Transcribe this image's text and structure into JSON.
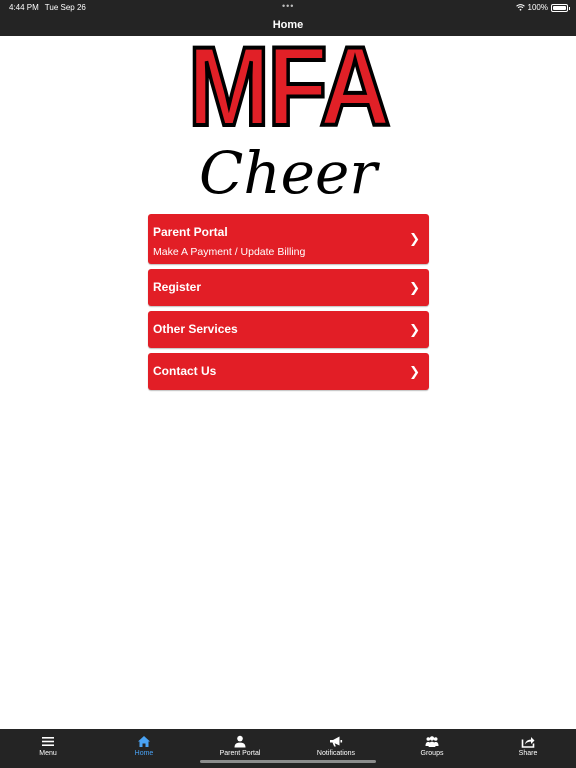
{
  "status": {
    "time": "4:44 PM",
    "date": "Tue Sep 26",
    "dots": "•••",
    "battery": "100%"
  },
  "nav": {
    "title": "Home"
  },
  "logo": {
    "primary": "MFA",
    "secondary": "Cheer"
  },
  "menu": {
    "items": [
      {
        "title": "Parent Portal",
        "subtitle": "Make A Payment / Update Billing",
        "chevron": "❯"
      },
      {
        "title": "Register",
        "chevron": "❯"
      },
      {
        "title": "Other Services",
        "chevron": "❯"
      },
      {
        "title": "Contact Us",
        "chevron": "❯"
      }
    ]
  },
  "tabs": [
    {
      "label": "Menu",
      "icon": "menu-icon",
      "active": false
    },
    {
      "label": "Home",
      "icon": "home-icon",
      "active": true
    },
    {
      "label": "Parent Portal",
      "icon": "person-icon",
      "active": false
    },
    {
      "label": "Notifications",
      "icon": "megaphone-icon",
      "active": false
    },
    {
      "label": "Groups",
      "icon": "groups-icon",
      "active": false
    },
    {
      "label": "Share",
      "icon": "share-icon",
      "active": false
    }
  ],
  "colors": {
    "bar": "#242424",
    "accent": "#e21e26",
    "active_tab": "#4aa3f5"
  }
}
